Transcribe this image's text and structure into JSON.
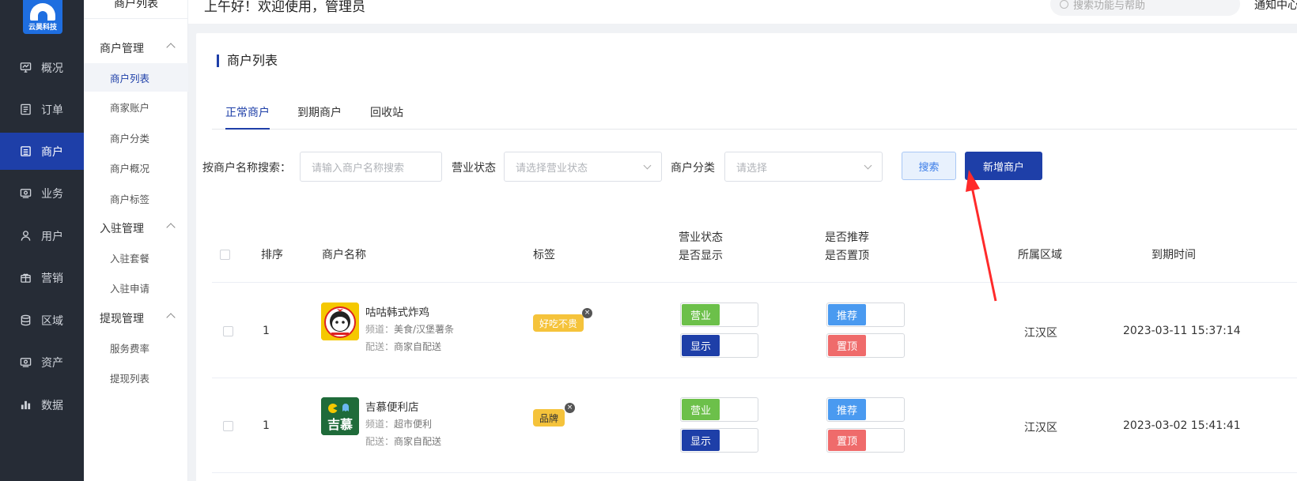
{
  "nav": {
    "logo_text": "云昊科技",
    "items": [
      {
        "label": "概况",
        "icon": "monitor-icon",
        "active": false
      },
      {
        "label": "订单",
        "icon": "list-icon",
        "active": false
      },
      {
        "label": "商户",
        "icon": "store-icon",
        "active": true
      },
      {
        "label": "业务",
        "icon": "briefcase-icon",
        "active": false
      },
      {
        "label": "用户",
        "icon": "user-icon",
        "active": false
      },
      {
        "label": "营销",
        "icon": "gift-icon",
        "active": false
      },
      {
        "label": "区域",
        "icon": "database-icon",
        "active": false
      },
      {
        "label": "资产",
        "icon": "wallet-icon",
        "active": false
      },
      {
        "label": "数据",
        "icon": "bar-chart-icon",
        "active": false
      }
    ]
  },
  "submenu": {
    "top_title": "商户列表",
    "groups": [
      {
        "label": "商户管理",
        "items": [
          "商户列表",
          "商家账户",
          "商户分类",
          "商户概况",
          "商户标签"
        ]
      },
      {
        "label": "入驻管理",
        "items": [
          "入驻套餐",
          "入驻申请"
        ]
      },
      {
        "label": "提现管理",
        "items": [
          "服务费率",
          "提现列表"
        ]
      }
    ],
    "active_item": "商户列表"
  },
  "header": {
    "greeting": "上午好！欢迎使用，管理员",
    "search_placeholder": "搜索功能与帮助",
    "notify": "通知中心"
  },
  "page": {
    "title": "商户列表",
    "tabs": [
      "正常商户",
      "到期商户",
      "回收站"
    ],
    "active_tab": 0
  },
  "filter": {
    "name_label": "按商户名称搜索：",
    "name_placeholder": "请输入商户名称搜索",
    "status_label": "营业状态",
    "status_placeholder": "请选择营业状态",
    "category_label": "商户分类",
    "category_placeholder": "请选择",
    "search_button": "搜索",
    "add_button": "新增商户"
  },
  "table": {
    "headers": {
      "order": "排序",
      "name": "商户名称",
      "tag": "标签",
      "status_1": "营业状态",
      "status_2": "是否显示",
      "recommend_1": "是否推荐",
      "recommend_2": "是否置顶",
      "region": "所属区域",
      "expire": "到期时间"
    },
    "rows": [
      {
        "order": "1",
        "name": "咕咕韩式炸鸡",
        "channel_label": "频道：",
        "channel": "美食/汉堡薯条",
        "delivery_label": "配送：",
        "delivery": "商家自配送",
        "tag": "好吃不贵",
        "open": "营业",
        "show": "显示",
        "recommend": "推荐",
        "top": "置顶",
        "region": "江汉区",
        "expire": "2023-03-11 15:37:14"
      },
      {
        "order": "1",
        "name": "吉慕便利店",
        "channel_label": "频道：",
        "channel": "超市便利",
        "delivery_label": "配送：",
        "delivery": "商家自配送",
        "tag": "品牌",
        "open": "营业",
        "show": "显示",
        "recommend": "推荐",
        "top": "置顶",
        "region": "江汉区",
        "expire": "2023-03-02 15:41:41",
        "logo_text": "吉慕"
      }
    ]
  },
  "colors": {
    "nav_bg": "#262c36",
    "accent": "#1e3fa8",
    "switch_green": "#6cc04a",
    "switch_blue": "#4a9af0",
    "switch_red": "#ef6b6b",
    "tag_yellow": "#f5c33b",
    "annotation_arrow": "#ff2a2a"
  }
}
